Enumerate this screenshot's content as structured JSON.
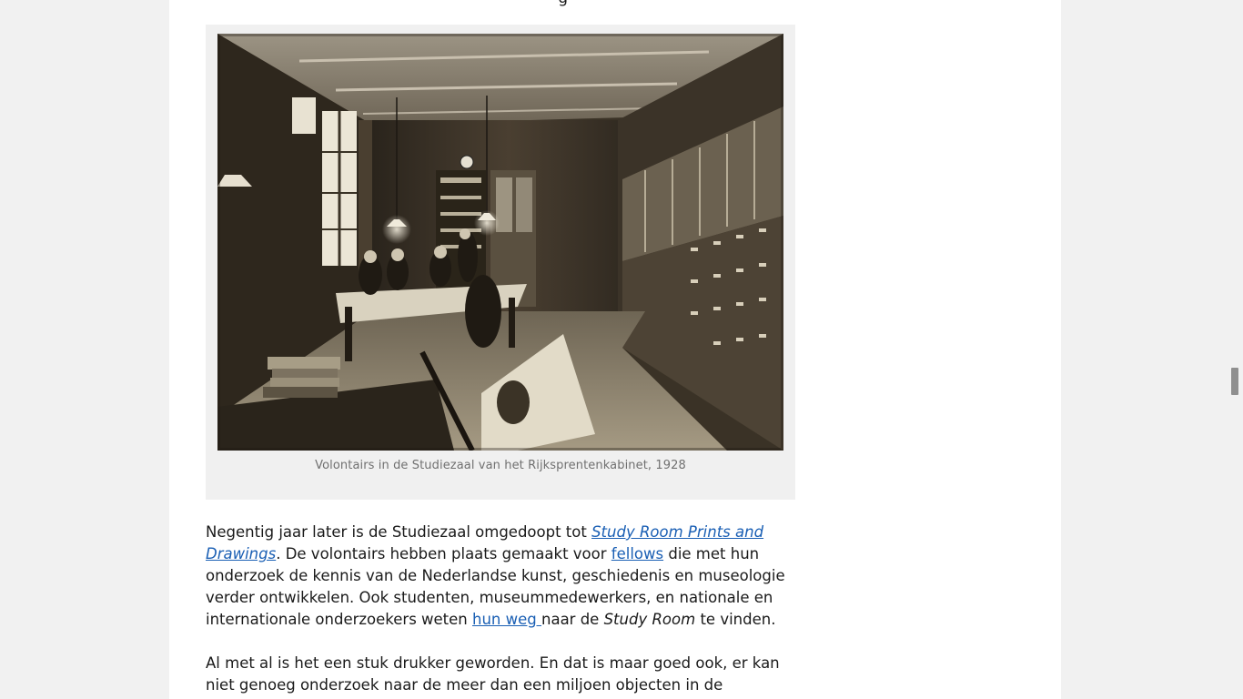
{
  "article": {
    "previous_line_fragment": "g",
    "figure": {
      "image_name": "studiezaal-1928-photo",
      "caption": "Volontairs in de Studiezaal van het Rijksprentenkabinet, 1928"
    },
    "paragraph_1": {
      "t1": "Negentig jaar later is de Studiezaal omgedoopt tot ",
      "link_study_room": "Study Room Prints and Drawings",
      "t2": ". De volontairs hebben plaats gemaakt voor ",
      "link_fellows": "fellows",
      "t3": " die met hun onderzoek de kennis van de Nederlandse kunst, geschiedenis en museologie verder ontwikkelen. Ook studenten, museummedewerkers, en nationale en internationale onderzoekers weten ",
      "link_hun_weg": "hun weg ",
      "t4": "naar de ",
      "em_study_room": "Study Room",
      "t5": " te vinden."
    },
    "paragraph_2": {
      "text": "Al met al is het een stuk drukker geworden. En dat is maar goed ook, er kan niet genoeg onderzoek naar de meer dan een miljoen objecten in de collectie worden"
    }
  },
  "colors": {
    "page_background": "#f1f1f1",
    "content_background": "#ffffff",
    "link": "#1a5fb4",
    "caption": "#707070"
  },
  "scrollbar": {
    "thumb_label": "scrollbar-thumb"
  }
}
